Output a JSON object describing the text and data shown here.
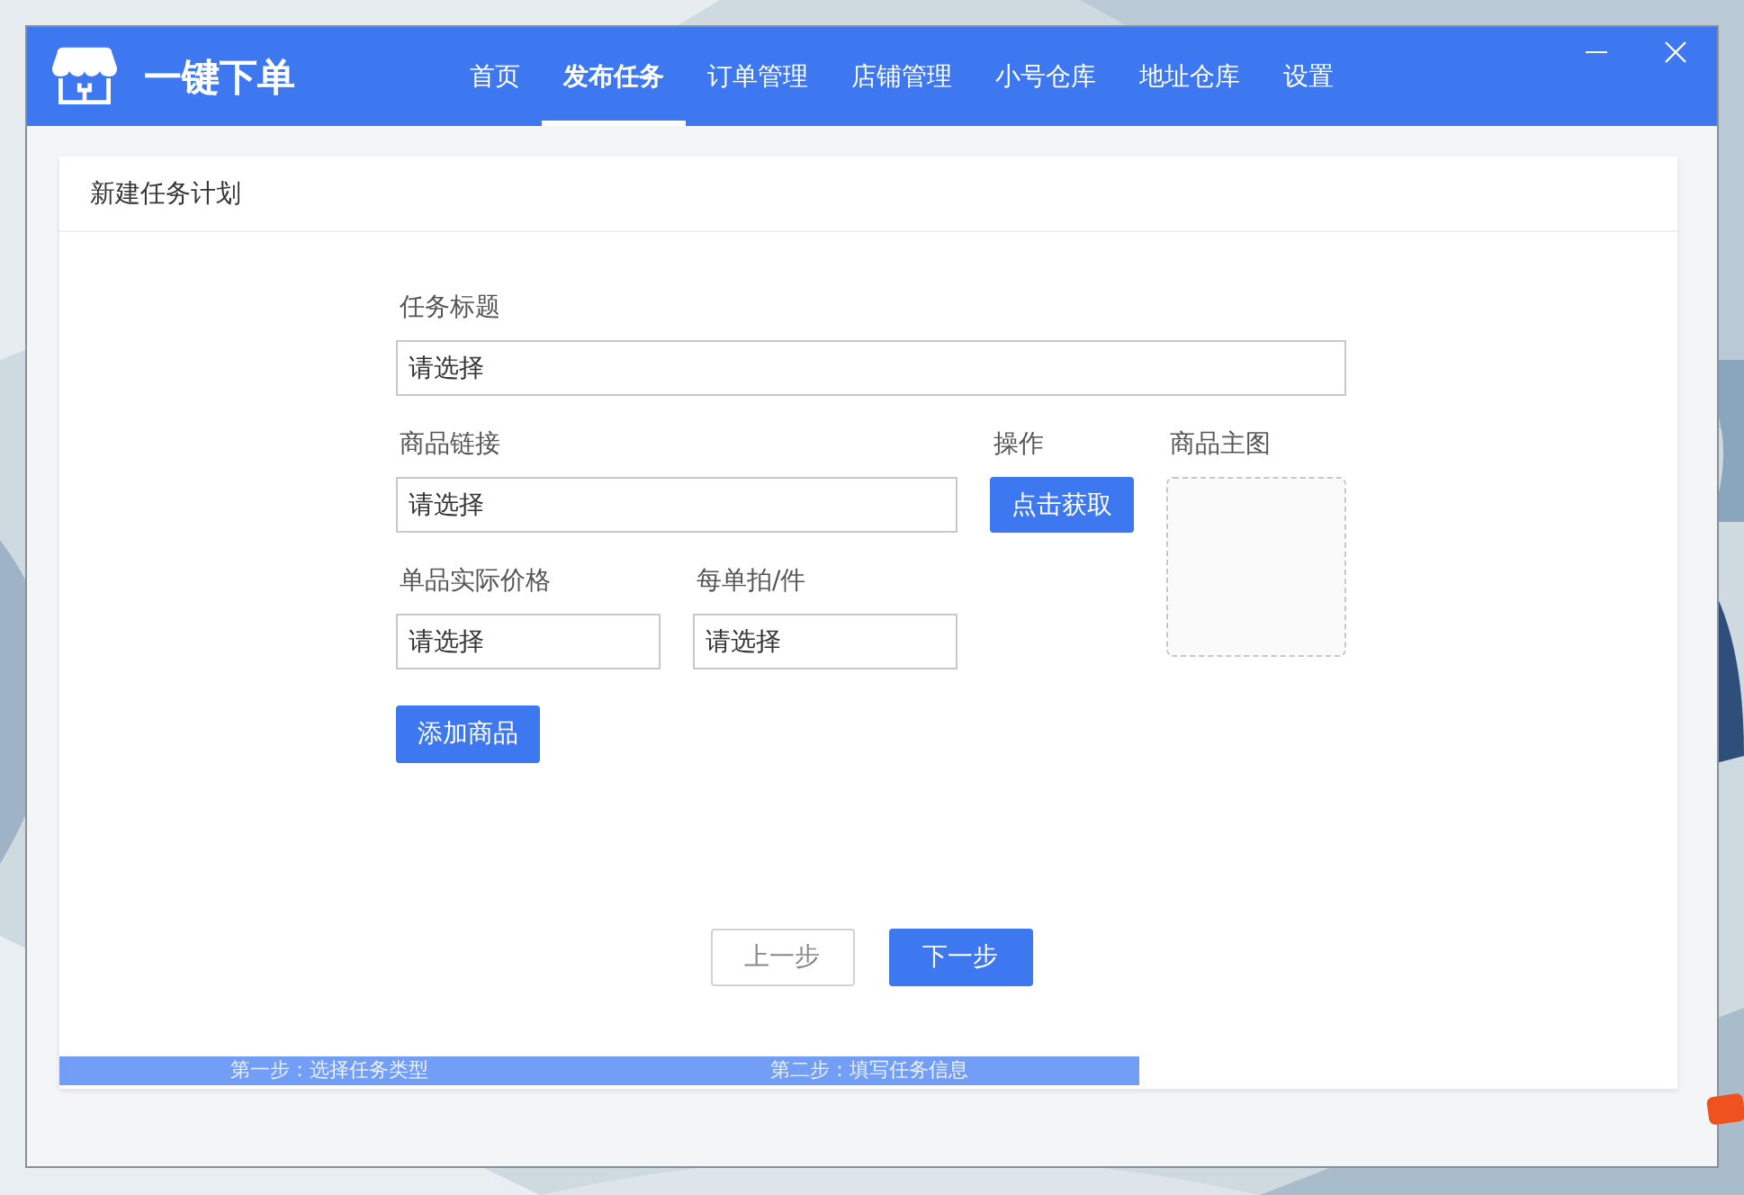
{
  "app": {
    "title": "一键下单"
  },
  "nav": [
    {
      "label": "首页",
      "selected": false
    },
    {
      "label": "发布任务",
      "selected": true
    },
    {
      "label": "订单管理",
      "selected": false
    },
    {
      "label": "店铺管理",
      "selected": false
    },
    {
      "label": "小号仓库",
      "selected": false
    },
    {
      "label": "地址仓库",
      "selected": false
    },
    {
      "label": "设置",
      "selected": false
    }
  ],
  "card": {
    "title": "新建任务计划"
  },
  "form": {
    "task_title": {
      "label": "任务标题",
      "value": "请选择"
    },
    "product_link": {
      "label": "商品链接",
      "value": "请选择"
    },
    "action": {
      "label": "操作",
      "button": "点击获取"
    },
    "main_image": {
      "label": "商品主图"
    },
    "unit_price": {
      "label": "单品实际价格",
      "value": "请选择"
    },
    "per_order": {
      "label": "每单拍/件",
      "value": "请选择"
    },
    "add_button": "添加商品"
  },
  "buttons": [
    {
      "label": "上一步",
      "kind": "secondary"
    },
    {
      "label": "下一步",
      "kind": "primary"
    }
  ],
  "steps": [
    "第一步：选择任务类型",
    "第二步：填写任务信息"
  ]
}
